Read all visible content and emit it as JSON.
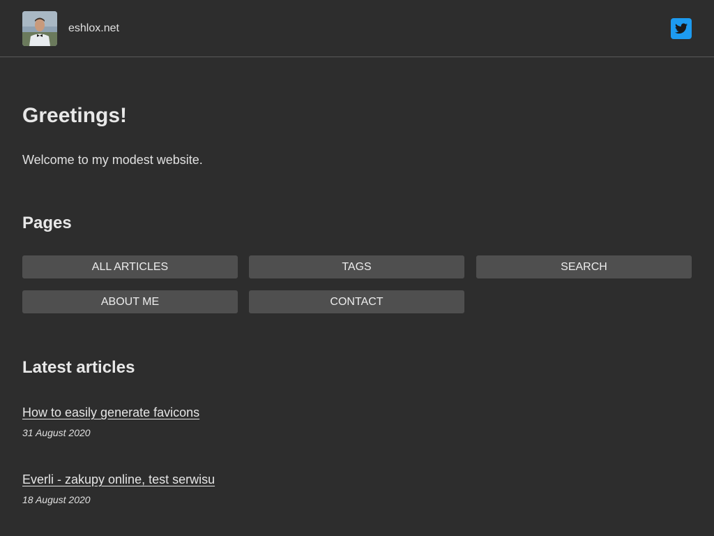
{
  "header": {
    "site_name": "eshlox.net",
    "avatar_icon": "profile-photo",
    "social_icon": "twitter-icon",
    "twitter_color": "#1d9bf0"
  },
  "intro": {
    "heading": "Greetings!",
    "text": "Welcome to my modest website."
  },
  "pages": {
    "heading": "Pages",
    "buttons": [
      {
        "label": "ALL ARTICLES"
      },
      {
        "label": "TAGS"
      },
      {
        "label": "SEARCH"
      },
      {
        "label": "ABOUT ME"
      },
      {
        "label": "CONTACT"
      }
    ]
  },
  "latest": {
    "heading": "Latest articles",
    "articles": [
      {
        "title": "How to easily generate favicons",
        "date": "31 August 2020"
      },
      {
        "title": "Everli - zakupy online, test serwisu",
        "date": "18 August 2020"
      }
    ]
  },
  "colors": {
    "background": "#2d2d2d",
    "button": "#4f4f4f",
    "text": "#e6e6e6"
  }
}
